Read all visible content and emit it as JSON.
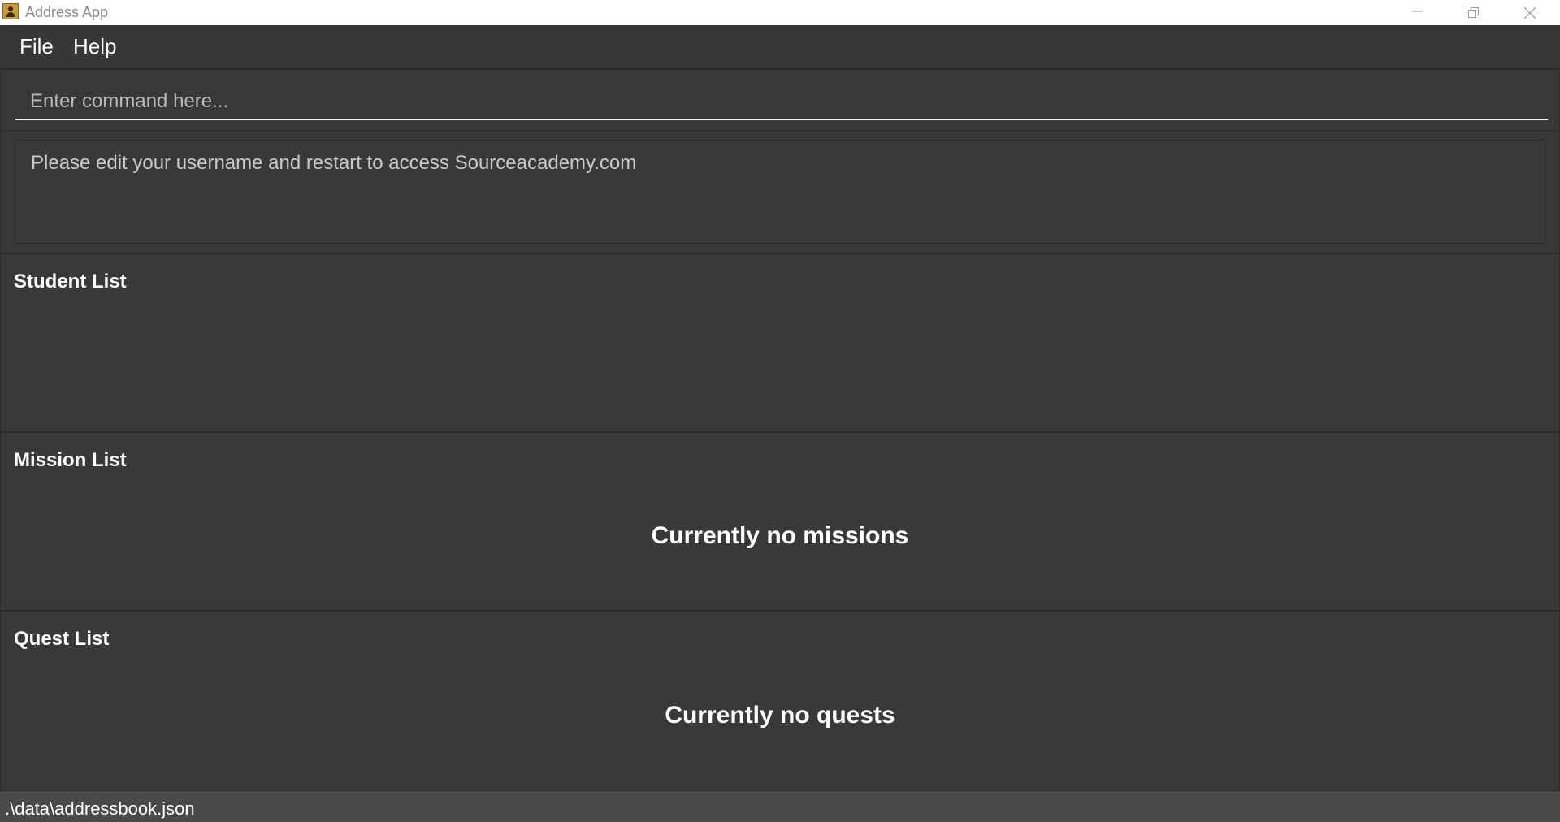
{
  "window": {
    "title": "Address App",
    "app_icon": "address-book-icon",
    "controls": [
      "minimize-icon",
      "restore-icon",
      "close-icon"
    ]
  },
  "menu": {
    "items": [
      {
        "label": "File"
      },
      {
        "label": "Help"
      }
    ]
  },
  "command": {
    "placeholder": "Enter command here...",
    "value": ""
  },
  "result": {
    "message": "Please edit your username and restart to access Sourceacademy.com"
  },
  "panels": {
    "student": {
      "title": "Student List",
      "empty_text": ""
    },
    "mission": {
      "title": "Mission List",
      "empty_text": "Currently no missions"
    },
    "quest": {
      "title": "Quest List",
      "empty_text": "Currently no quests"
    }
  },
  "status": {
    "file_path": ".\\data\\addressbook.json"
  },
  "colors": {
    "background": "#383838",
    "menubar": "#373737",
    "statusbar": "#4a4a4a",
    "text": "#ffffff"
  }
}
